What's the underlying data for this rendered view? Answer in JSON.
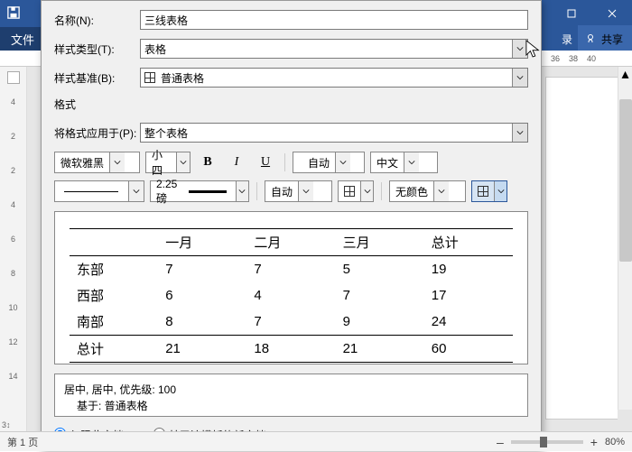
{
  "titlebar": {
    "login": "录",
    "share": "共享"
  },
  "menubar": {
    "file": "文件"
  },
  "ruler_h": [
    "36",
    "38",
    "40"
  ],
  "ruler_v": [
    "",
    "4",
    "",
    "2",
    "",
    "",
    "",
    "2",
    "",
    "4",
    "",
    "6",
    "",
    "8",
    "",
    "10",
    "",
    "12",
    "",
    "14"
  ],
  "dialog": {
    "name_label": "名称(N):",
    "name_value": "三线表格",
    "type_label": "样式类型(T):",
    "type_value": "表格",
    "base_label": "样式基准(B):",
    "base_value": "普通表格",
    "format_section": "格式",
    "apply_label": "将格式应用于(P):",
    "apply_value": "整个表格",
    "font_name": "微软雅黑",
    "font_size": "小四",
    "auto_color": "自动",
    "lang": "中文",
    "line_weight": "2.25 磅",
    "border_color": "自动",
    "fill_color": "无颜色",
    "desc_line1": "居中, 居中, 优先级: 100",
    "desc_line2": "基于: 普通表格",
    "radio1": "仅限此文档(D)",
    "radio2": "基于该模板的新文档",
    "preview": {
      "headers": [
        "",
        "一月",
        "二月",
        "三月",
        "总计"
      ],
      "rows": [
        {
          "label": "东部",
          "vals": [
            "7",
            "7",
            "5",
            "19"
          ]
        },
        {
          "label": "西部",
          "vals": [
            "6",
            "4",
            "7",
            "17"
          ]
        },
        {
          "label": "南部",
          "vals": [
            "8",
            "7",
            "9",
            "24"
          ]
        }
      ],
      "total": {
        "label": "总计",
        "vals": [
          "21",
          "18",
          "21",
          "60"
        ]
      }
    }
  },
  "chart_data": {
    "type": "table",
    "title": "",
    "columns": [
      "",
      "一月",
      "二月",
      "三月",
      "总计"
    ],
    "rows": [
      [
        "东部",
        7,
        7,
        5,
        19
      ],
      [
        "西部",
        6,
        4,
        7,
        17
      ],
      [
        "南部",
        8,
        7,
        9,
        24
      ],
      [
        "总计",
        21,
        18,
        21,
        60
      ]
    ]
  },
  "statusbar": {
    "page": "第 1 页",
    "zoom_plus": "+",
    "zoom_minus": "–",
    "zoom_pct": "80%"
  }
}
